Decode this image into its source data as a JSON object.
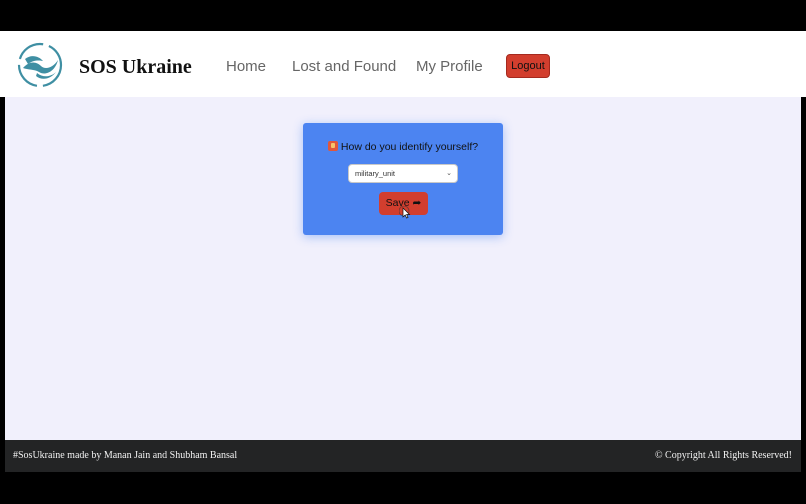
{
  "header": {
    "brand": "SOS Ukraine",
    "nav": [
      {
        "label": "Home"
      },
      {
        "label": "Lost and Found"
      },
      {
        "label": "My Profile"
      }
    ],
    "logout_label": "Logout",
    "logo_icon": "doves-logo-icon"
  },
  "form": {
    "question": "How do you identify yourself?",
    "question_icon": "id-badge-icon",
    "selected_value": "military_unit",
    "save_label": "Save",
    "save_icon": "arrow-right-icon"
  },
  "footer": {
    "left_text": "#SosUkraine made by Manan Jain and Shubham Bansal",
    "right_text": "© Copyright All Rights Reserved!"
  },
  "colors": {
    "header_bg": "#ffffff",
    "main_bg": "#f1f0fc",
    "card_bg": "#4c84f1",
    "accent_red": "#d23e2e",
    "footer_bg": "#232425"
  }
}
